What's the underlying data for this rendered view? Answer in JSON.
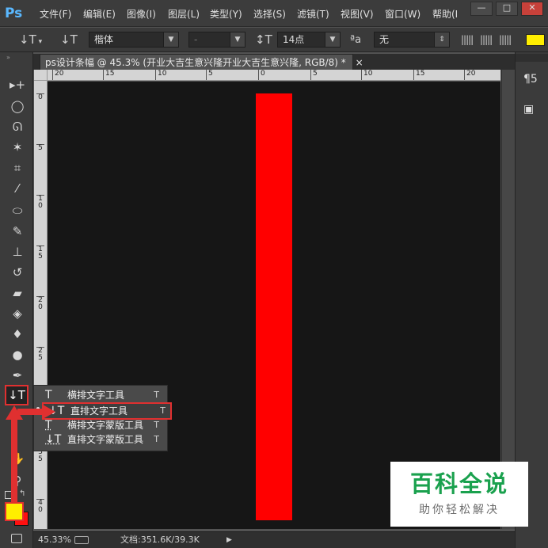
{
  "app": {
    "logo": "Ps",
    "menu": [
      "文件(F)",
      "编辑(E)",
      "图像(I)",
      "图层(L)",
      "类型(Y)",
      "选择(S)",
      "滤镜(T)",
      "视图(V)",
      "窗口(W)",
      "帮助(I"
    ],
    "window_controls": [
      "—",
      "□",
      "✕"
    ]
  },
  "options": {
    "font_family": "楷体",
    "font_style": "-",
    "font_size": "14点",
    "aa_label": "ªa",
    "antialias": "无",
    "text_color": "#ffee00"
  },
  "document": {
    "tab_title": "ps设计条幅 @ 45.3% (开业大吉生意兴隆开业大吉生意兴隆, RGB/8) *",
    "close": "×",
    "canvas_bg": "#161616",
    "bar_color": "#ff0000"
  },
  "rulers": {
    "h_ticks": [
      "20",
      "15",
      "10",
      "5",
      "0",
      "5",
      "10",
      "15",
      "20"
    ],
    "v_ticks": [
      "0",
      "5",
      "1 0",
      "1 5",
      "2 0",
      "2 5",
      "3 0",
      "3 5",
      "4 0"
    ]
  },
  "flyout": {
    "items": [
      {
        "icon": "T",
        "label": "横排文字工具",
        "key": "T"
      },
      {
        "icon": "↓T",
        "label": "直排文字工具",
        "key": "T"
      },
      {
        "icon": "T",
        "label": "横排文字蒙版工具",
        "key": "T"
      },
      {
        "icon": "↓T",
        "label": "直排文字蒙版工具",
        "key": "T"
      }
    ]
  },
  "colors": {
    "foreground": "#ffee00",
    "background": "#ff1010",
    "highlight": "#e03030"
  },
  "status": {
    "zoom": "45.33%",
    "doc_info": "文档:351.6K/39.3K",
    "arrow": "▶"
  },
  "watermark": {
    "main": "百科全说",
    "sub": "助你轻松解决"
  }
}
